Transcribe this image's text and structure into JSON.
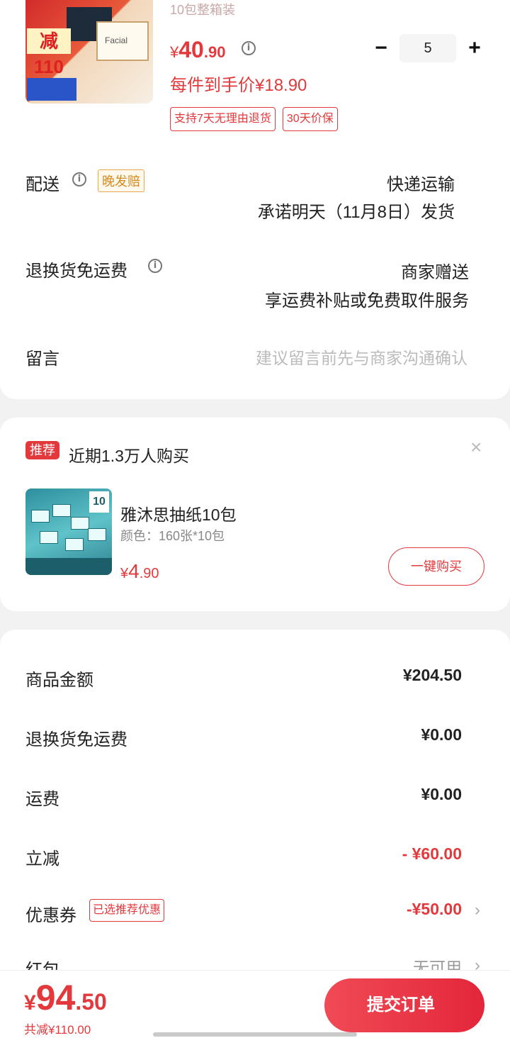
{
  "product": {
    "faded_title": "10包整箱装",
    "price": {
      "currency": "¥",
      "integer": "40",
      "decimal": ".90"
    },
    "unit_price": "每件到手价¥18.90",
    "tags": [
      "支持7天无理由退货",
      "30天价保"
    ],
    "quantity": "5",
    "minus": "−",
    "plus": "+",
    "image_brand": "Facial",
    "image_big": "减110"
  },
  "delivery": {
    "label": "配送",
    "tag": "晚发赔",
    "method": "快递运输",
    "promise": "承诺明天（11月8日）发货"
  },
  "return_shipping": {
    "label": "退换货免运费",
    "value1": "商家赠送",
    "value2": "享运费补贴或免费取件服务"
  },
  "message": {
    "label": "留言",
    "placeholder": "建议留言前先与商家沟通确认"
  },
  "recommend": {
    "badge": "推荐",
    "title": "近期1.3万人购买",
    "close": "×",
    "item_name": "雅沐思抽纸10包",
    "item_spec": "颜色：160张*10包",
    "price": {
      "currency": "¥",
      "integer": "4",
      "decimal": ".90"
    },
    "buy_label": "一键购买",
    "image_count": "10"
  },
  "summary": {
    "rows": [
      {
        "label": "商品金额",
        "value": "¥204.50"
      },
      {
        "label": "退换货免运费",
        "value": "¥0.00"
      },
      {
        "label": "运费",
        "value": "¥0.00"
      },
      {
        "label": "立减",
        "value": "- ¥60.00"
      },
      {
        "label": "优惠券",
        "value": "-¥50.00",
        "tag": "已选推荐优惠"
      },
      {
        "label": "红包",
        "value": "无可用"
      }
    ],
    "chevron": "›"
  },
  "footer": {
    "total": {
      "currency": "¥",
      "integer": "94",
      "decimal": ".50"
    },
    "saved": "共减¥110.00",
    "submit": "提交订单"
  },
  "colors": {
    "accent": "#e4393c",
    "gold": "#d68a20"
  }
}
